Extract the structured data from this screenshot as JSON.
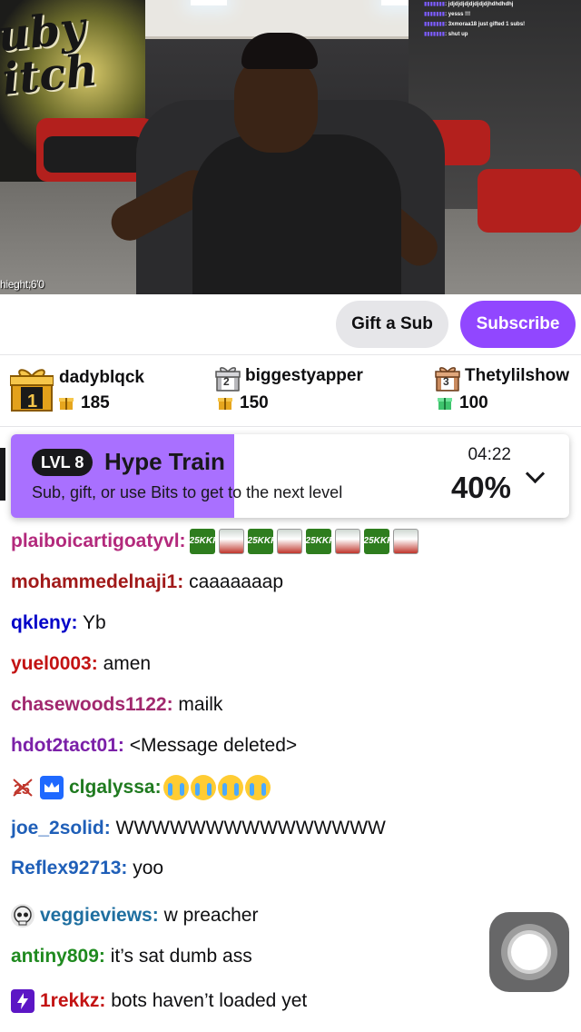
{
  "video": {
    "overlay_text": "hieght;6'0",
    "graffiti_text": "uby itch",
    "alerts": [
      {
        "user": "",
        "text": ": jdjdjdjdjdjdjdjdjhdhdhdhj"
      },
      {
        "user": "",
        "text": ": yesss !!!"
      },
      {
        "user": "",
        "text": ": 3xmoraa18 just gifted 1 subs!"
      },
      {
        "user": "",
        "text": ": shut up"
      }
    ]
  },
  "subscribe_bar": {
    "gift_label": "Gift a Sub",
    "subscribe_label": "Subscribe"
  },
  "leaderboard": [
    {
      "rank": "1",
      "name": "dadyblqck",
      "amount": "185"
    },
    {
      "rank": "2",
      "name": "biggestyapper",
      "amount": "150"
    },
    {
      "rank": "3",
      "name": "Thetylilshow",
      "amount": "100"
    }
  ],
  "hype_train": {
    "level": "LVL 8",
    "title": "Hype Train",
    "subtitle": "Sub, gift, or use Bits to get to the next level",
    "timer": "04:22",
    "percent_label": "40%",
    "progress": 0.4
  },
  "chat": [
    {
      "user": "plaiboicartigoatyvl:",
      "message": "",
      "color": "#b3297c",
      "emotes": [
        "25k",
        "face",
        "25k",
        "face",
        "25k",
        "face",
        "25k",
        "face"
      ],
      "badges": []
    },
    {
      "user": "mohammedelnaji1:",
      "message": " caaaaaaap",
      "color": "#a11a1a",
      "emotes": [],
      "badges": []
    },
    {
      "user": "qkleny:",
      "message": " Yb",
      "color": "#0000c8",
      "emotes": [],
      "badges": []
    },
    {
      "user": "yuel0003:",
      "message": " amen",
      "color": "#c31313",
      "emotes": [],
      "badges": []
    },
    {
      "user": "chasewoods1122:",
      "message": " mailk",
      "color": "#a1286e",
      "emotes": [],
      "badges": []
    },
    {
      "user": "hdot2tact01:",
      "message": " <Message deleted>",
      "color": "#7b20a8",
      "emotes": [],
      "badges": []
    },
    {
      "user": "clgalyssa:",
      "message": "",
      "color": "#1f7a1f",
      "emotes": [
        "cry",
        "cry",
        "cry",
        "cry"
      ],
      "badges": [
        "sub",
        "prime"
      ]
    },
    {
      "user": "joe_2solid:",
      "message": " WWWWWWWWWWWWWWW",
      "color": "#1f5fb8",
      "emotes": [],
      "badges": []
    },
    {
      "user": "Reflex92713:",
      "message": " yoo",
      "color": "#1f5fb8",
      "emotes": [],
      "badges": []
    },
    {
      "user": "veggieviews:",
      "message": " w preacher",
      "color": "#1f6fa0",
      "emotes": [],
      "badges": [
        "skull"
      ]
    },
    {
      "user": "antiny809:",
      "message": " it’s sat dumb ass",
      "color": "#1f8a1f",
      "emotes": [],
      "badges": []
    },
    {
      "user": "1rekkz:",
      "message": " bots haven’t loaded yet",
      "color": "#c31313",
      "emotes": [],
      "badges": [
        "turbo"
      ]
    }
  ],
  "icons": {
    "chevron": "chevron-down-icon",
    "assistive": "assistive-touch-icon"
  },
  "colors": {
    "accent": "#9147ff",
    "hype_fill": "#a970ff"
  }
}
